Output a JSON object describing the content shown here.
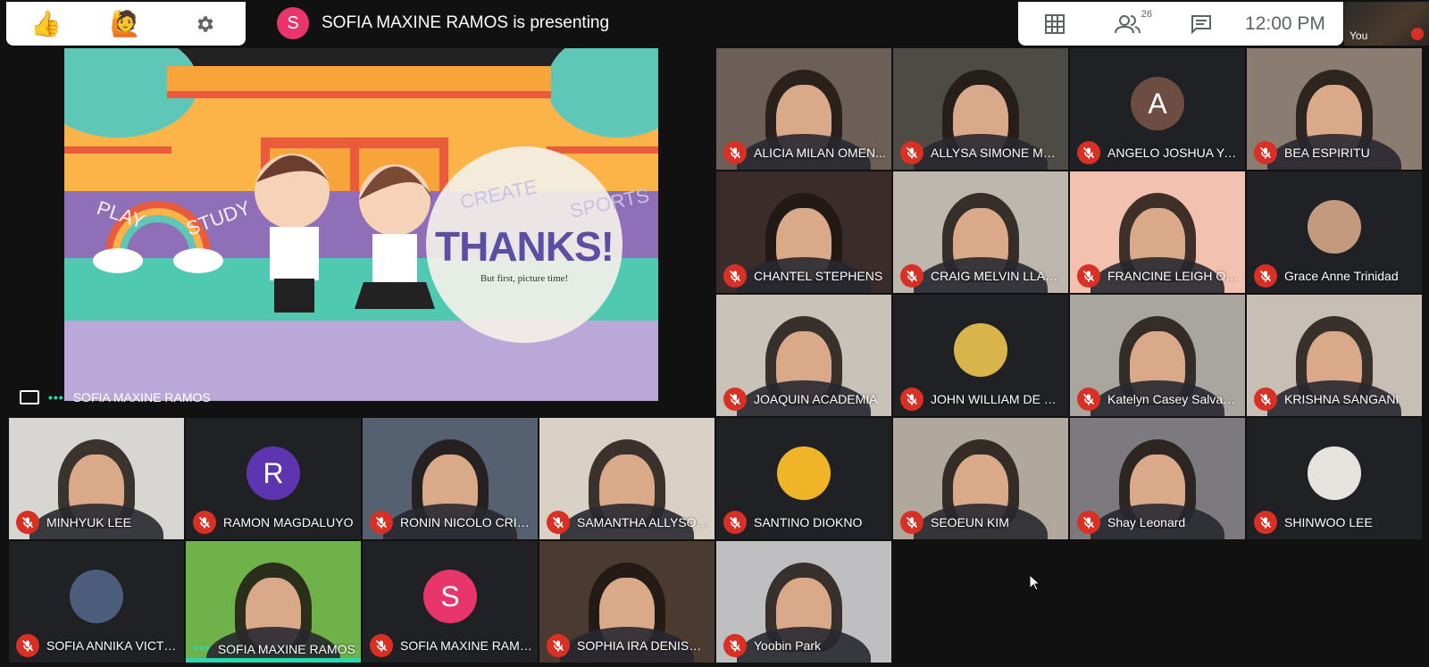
{
  "toolbar_left": {
    "thumbs_icon": "thumbs-up",
    "raise_hand_icon": "raise-hand",
    "settings_icon": "gear"
  },
  "presenting": {
    "avatar_letter": "S",
    "text": "SOFIA MAXINE RAMOS is presenting",
    "avatar_color": "#e8366d"
  },
  "toolbar_right": {
    "participant_count": "26",
    "time": "12:00 PM"
  },
  "self_view": {
    "label": "You"
  },
  "slide": {
    "title": "THANKS!",
    "subtitle": "But first, picture time!",
    "words": [
      "PLAY",
      "STUDY",
      "CREATE",
      "SPORTS"
    ]
  },
  "presenter_tile": {
    "name": "SOFIA MAXINE RAMOS"
  },
  "participants": [
    {
      "name": "ALICIA MILAN OMEN...",
      "bg": "#6b5f57"
    },
    {
      "name": "ALLYSA SIMONE MAR...",
      "bg": "#4e4a44"
    },
    {
      "name": "ANGELO JOSHUA YAP",
      "avatar": "A",
      "avatar_color": "#6d4c41"
    },
    {
      "name": "BEA ESPIRITU",
      "bg": "#8a7c70"
    },
    {
      "name": "CHANTEL STEPHENS",
      "bg": "#3a2c2b"
    },
    {
      "name": "CRAIG MELVIN LLADO",
      "bg": "#bdb7ad"
    },
    {
      "name": "FRANCINE LEIGH OLF...",
      "bg": "#f2c1b0"
    },
    {
      "name": "Grace Anne Trinidad",
      "avatar": "",
      "avatar_color": "#c49a7e"
    },
    {
      "name": "JOAQUIN ACADEMIA",
      "bg": "#c8c2b9"
    },
    {
      "name": "JOHN WILLIAM DE C...",
      "avatar": "",
      "avatar_color": "#d8b44a"
    },
    {
      "name": "Katelyn Casey Salvad...",
      "bg": "#a9a59f"
    },
    {
      "name": "KRISHNA SANGANI",
      "bg": "#c7bfb6"
    },
    {
      "name": "MINHYUK LEE",
      "bg": "#d8d6d2"
    },
    {
      "name": "RAMON MAGDALUYO",
      "avatar": "R",
      "avatar_color": "#5e35b1"
    },
    {
      "name": "RONIN NICOLO CRISO...",
      "bg": "#556070"
    },
    {
      "name": "SAMANTHA ALLYSON...",
      "bg": "#d9d1c6"
    },
    {
      "name": "SANTINO DIOKNO",
      "avatar": "",
      "avatar_color": "#f0b429"
    },
    {
      "name": "SEOEUN KIM",
      "bg": "#b0a89c"
    },
    {
      "name": "Shay Leonard",
      "bg": "#7c7a7e"
    },
    {
      "name": "SHINWOO LEE",
      "avatar": "",
      "avatar_color": "#e6e3df"
    },
    {
      "name": "SOFIA ANNIKA VICTO...",
      "avatar": "",
      "avatar_color": "#4b5d7a"
    },
    {
      "name": "SOFIA MAXINE RAMOS",
      "bg": "#6fb24a",
      "talking": true
    },
    {
      "name": "SOFIA MAXINE RAMOS",
      "avatar": "S",
      "avatar_color": "#e8366d"
    },
    {
      "name": "SOPHIA IRA DENISE R...",
      "bg": "#4b3a30"
    },
    {
      "name": "Yoobin Park",
      "bg": "#bfbfc2"
    }
  ]
}
